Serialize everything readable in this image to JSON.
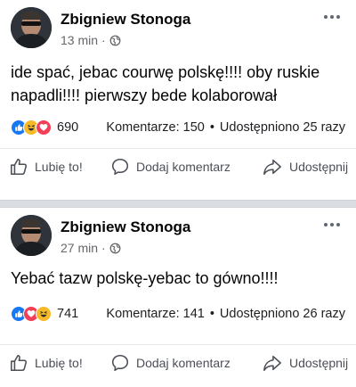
{
  "posts": [
    {
      "author": "Zbigniew Stonoga",
      "time": "13 min",
      "separator": "·",
      "text": "ide spać,  jebac courwę  polskę!!!! oby ruskie napadli!!!! pierwszy bede kolaborował",
      "reaction_count": "690",
      "comments": "Komentarze: 150",
      "shares": "Udostępniono 25 razy",
      "reactions": [
        "like",
        "haha",
        "love"
      ]
    },
    {
      "author": "Zbigniew Stonoga",
      "time": "27 min",
      "separator": "·",
      "text": "Yebać tazw polskę-yebac to gówno!!!!",
      "reaction_count": "741",
      "comments": "Komentarze: 141",
      "shares": "Udostępniono 26 razy",
      "reactions": [
        "like",
        "love",
        "haha"
      ]
    }
  ],
  "stats_separator": "•",
  "actions": {
    "like": "Lubię to!",
    "comment": "Dodaj komentarz",
    "share": "Udostępnij"
  },
  "icons": {
    "globe": "globe-icon",
    "more": "more-options-icon",
    "like": "thumbs-up-icon",
    "comment": "comment-bubble-icon",
    "share": "share-arrow-icon"
  },
  "colors": {
    "like": "#1877f2",
    "love": "#f33e58",
    "haha": "#f7b928",
    "secondary_text": "#65676b",
    "separator": "#dadde1"
  }
}
